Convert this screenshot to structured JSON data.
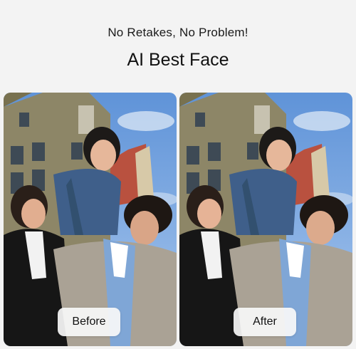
{
  "header": {
    "tagline": "No Retakes, No Problem!",
    "title": "AI Best Face"
  },
  "comparison": {
    "before_label": "Before",
    "after_label": "After"
  },
  "colors": {
    "page_background": "#f3f3f3",
    "sky": "#6fa0df",
    "building_wall": "#8c8464",
    "roof_red": "#b9513f"
  }
}
